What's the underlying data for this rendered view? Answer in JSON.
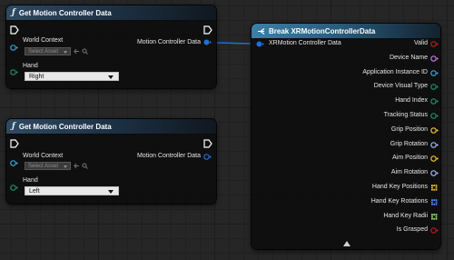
{
  "nodes": {
    "get_right": {
      "title": "Get Motion Controller Data",
      "world_context_label": "World Context",
      "asset_placeholder": "Select Asset",
      "output_label": "Motion Controller Data",
      "hand_label": "Hand",
      "hand_value": "Right"
    },
    "get_left": {
      "title": "Get Motion Controller Data",
      "world_context_label": "World Context",
      "asset_placeholder": "Select Asset",
      "output_label": "Motion Controller Data",
      "hand_label": "Hand",
      "hand_value": "Left"
    },
    "break": {
      "title": "Break XRMotionControllerData",
      "input_label": "XRMotion Controller Data",
      "outputs": [
        {
          "label": "Valid",
          "color": "#b81d1d",
          "shape": "circle"
        },
        {
          "label": "Device Name",
          "color": "#c47be8",
          "shape": "circle"
        },
        {
          "label": "Application Instance ID",
          "color": "#36a4d9",
          "shape": "circle"
        },
        {
          "label": "Device Visual Type",
          "color": "#1d8c6e",
          "shape": "circle"
        },
        {
          "label": "Hand Index",
          "color": "#1d8c6e",
          "shape": "circle"
        },
        {
          "label": "Tracking Status",
          "color": "#1d8c6e",
          "shape": "circle"
        },
        {
          "label": "Grip Position",
          "color": "#f2c230",
          "shape": "circle"
        },
        {
          "label": "Grip Rotation",
          "color": "#9fb7ef",
          "shape": "circle"
        },
        {
          "label": "Aim Position",
          "color": "#f2c230",
          "shape": "circle"
        },
        {
          "label": "Aim Rotation",
          "color": "#9fb7ef",
          "shape": "circle"
        },
        {
          "label": "Hand Key Positions",
          "color": "#f2c230",
          "shape": "grid"
        },
        {
          "label": "Hand Key Rotations",
          "color": "#4d8cf5",
          "shape": "grid"
        },
        {
          "label": "Hand Key Radii",
          "color": "#8fe36a",
          "shape": "grid"
        },
        {
          "label": "Is Grasped",
          "color": "#b81d1d",
          "shape": "circle"
        }
      ]
    }
  },
  "colors": {
    "struct_pin": "#1f6fd6",
    "enum_pin": "#1d8c6e",
    "object_pin": "#36a4d9"
  },
  "icons": {
    "function": "f",
    "exec": "exec-pin-icon",
    "browse": "arrow-left-icon",
    "search": "search-icon"
  }
}
